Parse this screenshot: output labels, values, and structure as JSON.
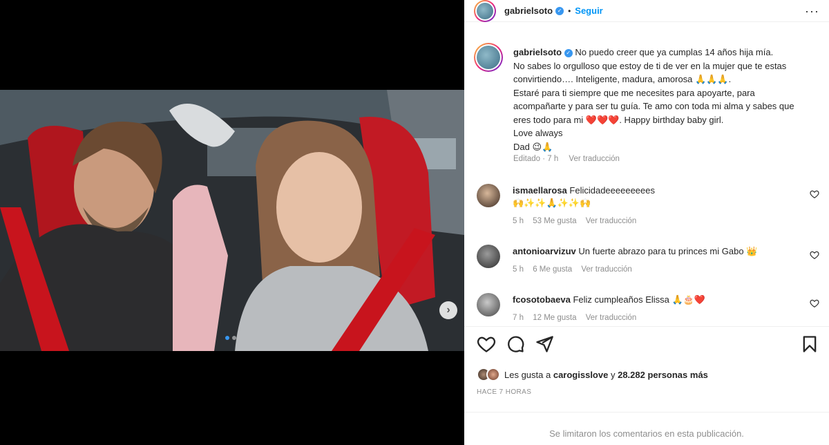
{
  "post": {
    "username": "gabrielsoto",
    "follow_label": "Seguir",
    "separator": "•",
    "more_label": "···",
    "caption": "No puedo creer que ya cumplas 14 años hija mía.\nNo sabes lo orgulloso que estoy de ti de ver en la mujer que te estas convirtiendo…. Inteligente, madura, amorosa 🙏🙏🙏.\nEstaré para ti siempre que me necesites para apoyarte, para acompañarte y para ser tu guía. Te amo con toda mi alma y sabes que eres todo para mi ❤️❤️❤️. Happy birthday baby girl.\nLove always\nDad 😉🙏",
    "edited_time": "Editado · 7 h",
    "translate_label": "Ver traducción"
  },
  "comments": [
    {
      "username": "ismaellarosa",
      "text": "Felicidadeeeeeeeees",
      "emojis": "🙌✨✨🙏✨✨🙌",
      "time": "5 h",
      "likes": "53 Me gusta",
      "translate": "Ver traducción"
    },
    {
      "username": "antonioarvizuv",
      "text": "Un fuerte abrazo para tu princes mi Gabo 👑",
      "time": "5 h",
      "likes": "6 Me gusta",
      "translate": "Ver traducción"
    },
    {
      "username": "fcosotobaeva",
      "text": "Feliz cumpleaños Elissa 🙏🎂❤️",
      "time": "7 h",
      "likes": "12 Me gusta",
      "translate": "Ver traducción"
    }
  ],
  "likes": {
    "prefix": "Les gusta a",
    "user": "carogisslove",
    "joiner": "y",
    "others": "28.282 personas más"
  },
  "time_ago": "HACE 7 HORAS",
  "comments_limited": "Se limitaron los comentarios en esta publicación.",
  "icons": [
    "heart-icon",
    "comment-icon",
    "share-icon",
    "bookmark-icon",
    "more-icon",
    "verified-icon",
    "chevron-right-icon"
  ],
  "colors": {
    "accent": "#0095f6",
    "verified": "#3897f0",
    "muted": "#8e8e8e",
    "text": "#262626"
  }
}
